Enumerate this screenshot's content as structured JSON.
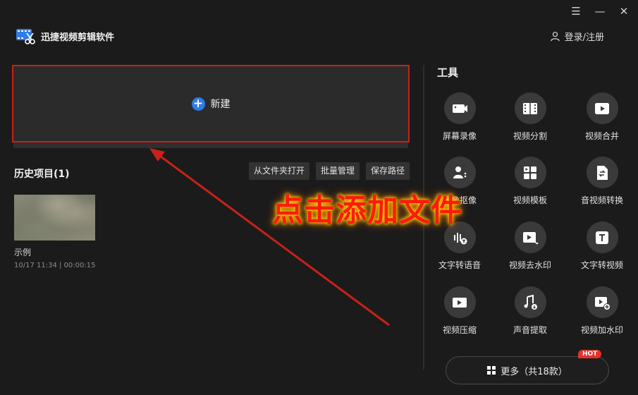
{
  "window": {
    "menu_icon": "menu-icon",
    "minimize_icon": "minimize-icon",
    "close_icon": "close-icon"
  },
  "app": {
    "title": "迅捷视频剪辑软件"
  },
  "header": {
    "login_label": "登录/注册"
  },
  "new_project": {
    "label": "新建"
  },
  "history": {
    "title": "历史项目(1)",
    "buttons": [
      "从文件夹打开",
      "批量管理",
      "保存路径"
    ],
    "projects": [
      {
        "name": "示例",
        "meta": "10/17 11:34 | 00:00:15"
      }
    ]
  },
  "tools": {
    "title": "工具",
    "items": [
      {
        "label": "屏幕录像",
        "icon": "camera-icon"
      },
      {
        "label": "视频分割",
        "icon": "film-split-icon"
      },
      {
        "label": "视频合并",
        "icon": "video-merge-icon"
      },
      {
        "label": "人像抠像",
        "icon": "portrait-icon"
      },
      {
        "label": "视频模板",
        "icon": "template-icon"
      },
      {
        "label": "音视频转换",
        "icon": "convert-icon"
      },
      {
        "label": "文字转语音",
        "icon": "text-to-speech-icon"
      },
      {
        "label": "视频去水印",
        "icon": "remove-watermark-icon"
      },
      {
        "label": "文字转视频",
        "icon": "text-to-video-icon"
      },
      {
        "label": "视频压缩",
        "icon": "compress-icon"
      },
      {
        "label": "声音提取",
        "icon": "audio-extract-icon"
      },
      {
        "label": "视频加水印",
        "icon": "add-watermark-icon"
      }
    ],
    "more_label": "更多（共18款）",
    "hot_badge": "HOT"
  },
  "annotation": {
    "text": "点击添加文件",
    "color": "#ff1a0d",
    "arrow_color": "#c8211a"
  },
  "colors": {
    "accent": "#2f7bea",
    "highlight_border": "#c8211a",
    "background": "#1b1b1b"
  }
}
